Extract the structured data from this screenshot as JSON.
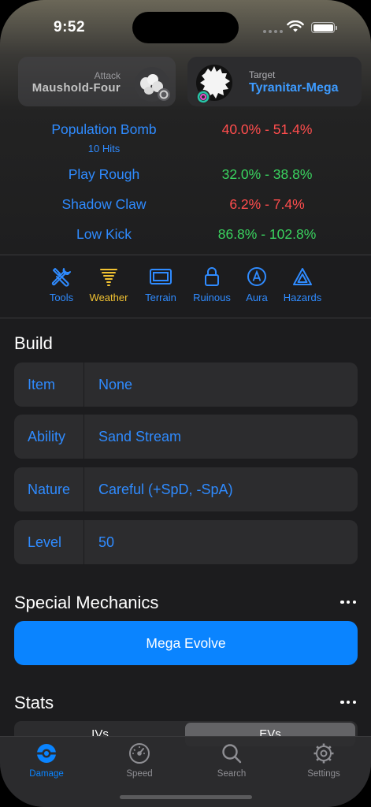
{
  "status": {
    "time": "9:52"
  },
  "attacker": {
    "caption": "Attack",
    "name": "Maushold-Four"
  },
  "target": {
    "caption": "Target",
    "name": "Tyranitar-Mega"
  },
  "moves": [
    {
      "name": "Population Bomb",
      "sub": "10 Hits",
      "damage": "40.0% - 51.4%",
      "color": "#ff4d4d"
    },
    {
      "name": "Play Rough",
      "sub": "",
      "damage": "32.0% - 38.8%",
      "color": "#3ad25f"
    },
    {
      "name": "Shadow Claw",
      "sub": "",
      "damage": "6.2% - 7.4%",
      "color": "#ff4d4d"
    },
    {
      "name": "Low Kick",
      "sub": "",
      "damage": "86.8% - 102.8%",
      "color": "#3ad25f"
    }
  ],
  "toolbar": [
    {
      "label": "Tools",
      "icon": "tools-icon"
    },
    {
      "label": "Weather",
      "icon": "tornado-icon",
      "color": "#f1c232"
    },
    {
      "label": "Terrain",
      "icon": "terrain-icon"
    },
    {
      "label": "Ruinous",
      "icon": "lock-icon"
    },
    {
      "label": "Aura",
      "icon": "aura-icon"
    },
    {
      "label": "Hazards",
      "icon": "hazard-triangle-icon"
    }
  ],
  "build": {
    "title": "Build",
    "fields": [
      {
        "label": "Item",
        "value": "None"
      },
      {
        "label": "Ability",
        "value": "Sand Stream"
      },
      {
        "label": "Nature",
        "value": "Careful (+SpD, -SpA)"
      },
      {
        "label": "Level",
        "value": "50"
      }
    ]
  },
  "special": {
    "title": "Special Mechanics",
    "button": "Mega Evolve"
  },
  "stats": {
    "title": "Stats",
    "segments": [
      "IVs",
      "EVs"
    ],
    "selected": "EVs"
  },
  "tabs": [
    {
      "label": "Damage",
      "icon": "pokeball-icon",
      "active": true
    },
    {
      "label": "Speed",
      "icon": "speedometer-icon",
      "active": false
    },
    {
      "label": "Search",
      "icon": "search-icon",
      "active": false
    },
    {
      "label": "Settings",
      "icon": "gear-icon",
      "active": false
    }
  ],
  "colors": {
    "accent": "#0a84ff",
    "link": "#2f8bff",
    "bad": "#ff4d4d",
    "good": "#3ad25f",
    "weather": "#f1c232"
  }
}
